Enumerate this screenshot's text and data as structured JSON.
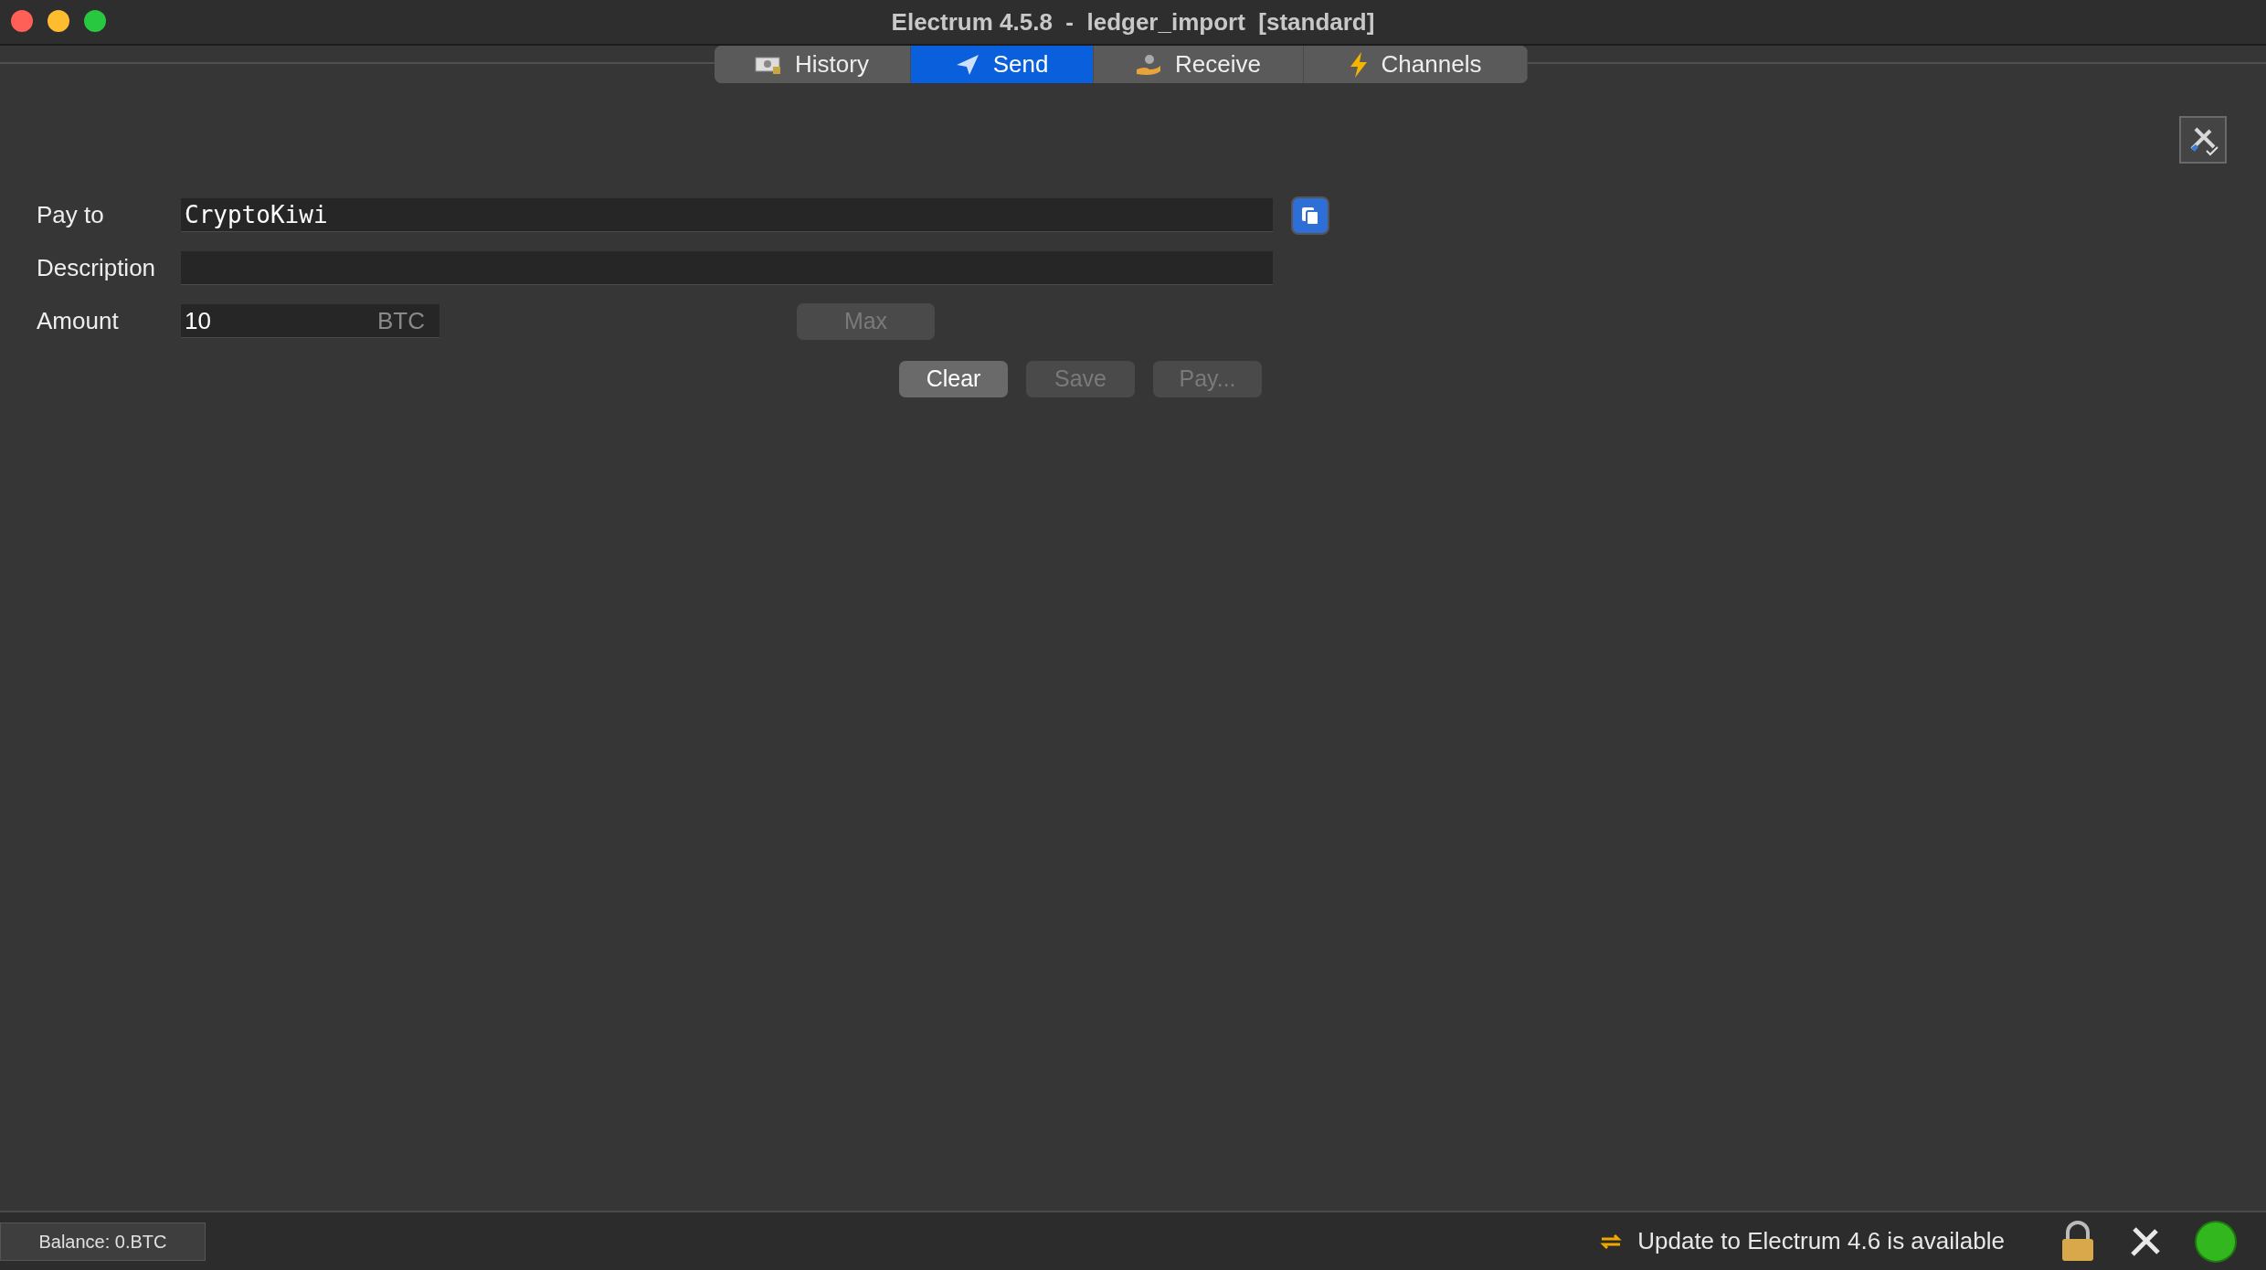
{
  "window": {
    "title": "Electrum 4.5.8  -  ledger_import  [standard]"
  },
  "tabs": [
    {
      "label": "History",
      "selected": false
    },
    {
      "label": "Send",
      "selected": true
    },
    {
      "label": "Receive",
      "selected": false
    },
    {
      "label": "Channels",
      "selected": false
    }
  ],
  "form": {
    "fields": [
      {
        "label": "Pay to",
        "value": "CryptoKiwi",
        "kind": "address"
      },
      {
        "label": "Description",
        "kind": "text"
      },
      {
        "label": "Amount",
        "value": "10",
        "unit": "BTC",
        "kind": "amount"
      }
    ],
    "max_button": {
      "label": "Max",
      "disabled": true
    },
    "buttons": [
      {
        "label": "Clear",
        "disabled": false
      },
      {
        "label": "Save",
        "disabled": true
      },
      {
        "label": "Pay...",
        "disabled": true
      }
    ]
  },
  "status_bar": {
    "balance": "Balance: 0.BTC",
    "update_message": "Update to Electrum 4.6 is available"
  }
}
